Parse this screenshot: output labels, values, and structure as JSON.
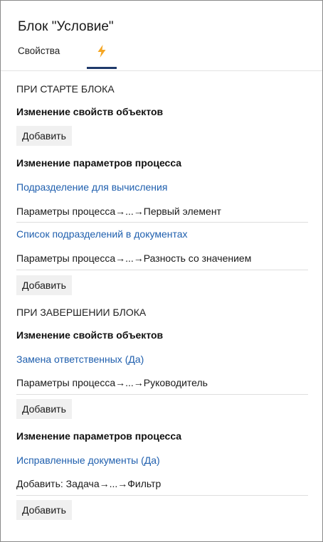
{
  "header": {
    "title": "Блок \"Условие\"",
    "tab_properties": "Свойства",
    "tab_events_icon": "lightning-icon",
    "accent_color": "#f5a623",
    "underline_color": "#1f3a6b"
  },
  "on_start": {
    "section_label": "ПРИ СТАРТЕ БЛОКА",
    "object_props_label": "Изменение свойств объектов",
    "object_props_add": "Добавить",
    "process_params_label": "Изменение параметров процесса",
    "items": [
      {
        "link": "Подразделение для вычисления",
        "value": "Параметры процесса→...→Первый элемент"
      },
      {
        "link": "Список подразделений в документах",
        "value": "Параметры процесса→...→Разность со значением"
      }
    ],
    "process_params_add": "Добавить"
  },
  "on_finish": {
    "section_label": "ПРИ ЗАВЕРШЕНИИ БЛОКА",
    "object_props_label": "Изменение свойств объектов",
    "object_items": [
      {
        "link": "Замена ответственных (Да)",
        "value": "Параметры процесса→...→Руководитель"
      }
    ],
    "object_props_add": "Добавить",
    "process_params_label": "Изменение параметров процесса",
    "process_items": [
      {
        "link": "Исправленные документы (Да)",
        "value": "Добавить: Задача→...→Фильтр"
      }
    ],
    "process_params_add": "Добавить"
  }
}
